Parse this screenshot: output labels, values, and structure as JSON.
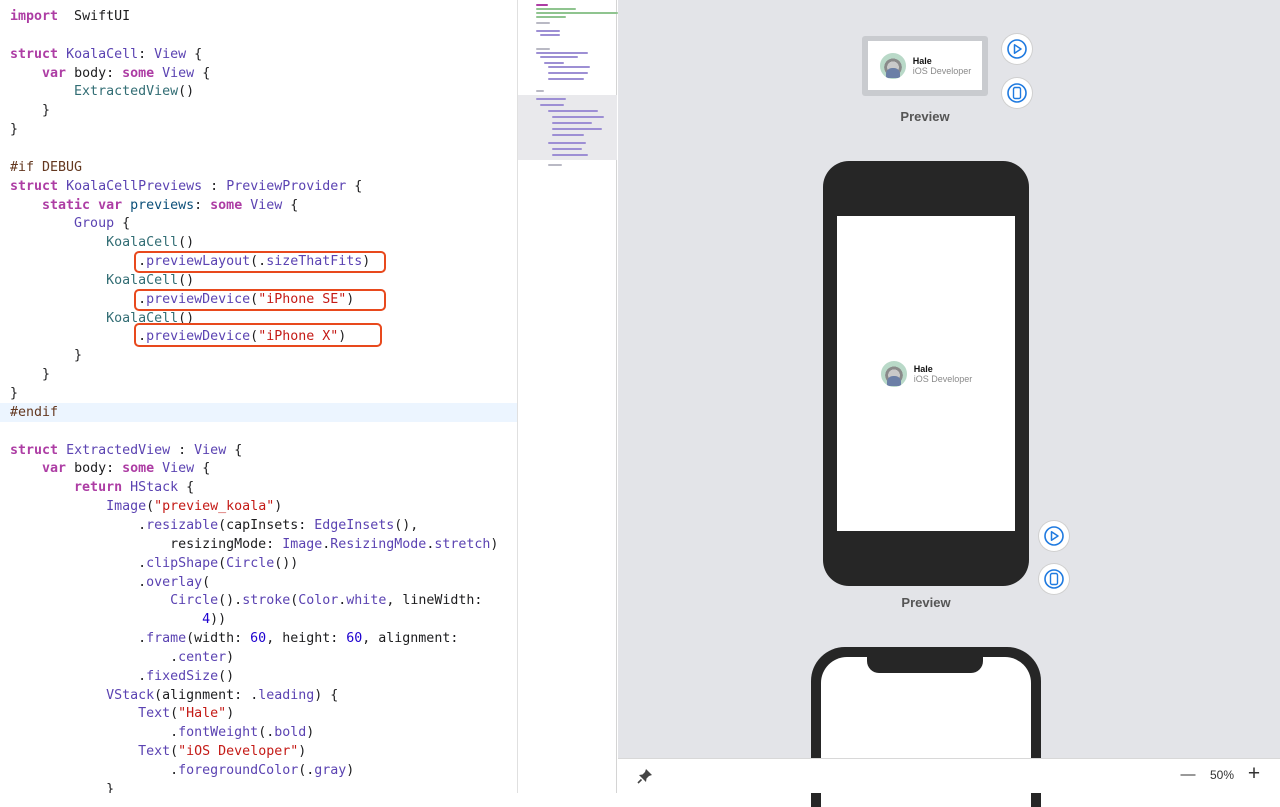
{
  "code_lines": [
    {
      "n": 1,
      "parts": [
        [
          "kw",
          "import"
        ],
        [
          "",
          "  SwiftUI"
        ]
      ]
    },
    {
      "n": 2,
      "parts": []
    },
    {
      "n": 3,
      "parts": [
        [
          "kw",
          "struct"
        ],
        [
          "",
          " "
        ],
        [
          "ty",
          "KoalaCell"
        ],
        [
          "",
          ": "
        ],
        [
          "ty",
          "View"
        ],
        [
          "",
          " {"
        ]
      ]
    },
    {
      "n": 4,
      "parts": [
        [
          "",
          "    "
        ],
        [
          "kw",
          "var"
        ],
        [
          "",
          " body: "
        ],
        [
          "kw",
          "some"
        ],
        [
          "",
          " "
        ],
        [
          "ty",
          "View"
        ],
        [
          "",
          " {"
        ]
      ]
    },
    {
      "n": 5,
      "parts": [
        [
          "",
          "        "
        ],
        [
          "dt",
          "ExtractedView"
        ],
        [
          "",
          "()"
        ]
      ]
    },
    {
      "n": 6,
      "parts": [
        [
          "",
          "    }"
        ]
      ]
    },
    {
      "n": 7,
      "parts": [
        [
          "",
          "}"
        ]
      ]
    },
    {
      "n": 8,
      "parts": []
    },
    {
      "n": 9,
      "parts": [
        [
          "pp",
          "#if DEBUG"
        ]
      ]
    },
    {
      "n": 10,
      "parts": [
        [
          "kw",
          "struct"
        ],
        [
          "",
          " "
        ],
        [
          "ty",
          "KoalaCellPreviews"
        ],
        [
          "",
          " : "
        ],
        [
          "ty",
          "PreviewProvider"
        ],
        [
          "",
          " {"
        ]
      ]
    },
    {
      "n": 11,
      "parts": [
        [
          "",
          "    "
        ],
        [
          "kw",
          "static var"
        ],
        [
          "",
          " "
        ],
        [
          "cl",
          "previews"
        ],
        [
          "",
          ": "
        ],
        [
          "kw",
          "some"
        ],
        [
          "",
          " "
        ],
        [
          "ty",
          "View"
        ],
        [
          "",
          " {"
        ]
      ]
    },
    {
      "n": 12,
      "parts": [
        [
          "",
          "        "
        ],
        [
          "ty",
          "Group"
        ],
        [
          "",
          " {"
        ]
      ]
    },
    {
      "n": 13,
      "parts": [
        [
          "",
          "            "
        ],
        [
          "dt",
          "KoalaCell"
        ],
        [
          "",
          "()"
        ]
      ]
    },
    {
      "n": 14,
      "parts": [
        [
          "",
          "                ."
        ],
        [
          "ty",
          "previewLayout"
        ],
        [
          "",
          "(."
        ],
        [
          "ty",
          "sizeThatFits"
        ],
        [
          "",
          ")"
        ]
      ]
    },
    {
      "n": 15,
      "parts": [
        [
          "",
          "            "
        ],
        [
          "dt",
          "KoalaCell"
        ],
        [
          "",
          "()"
        ]
      ]
    },
    {
      "n": 16,
      "parts": [
        [
          "",
          "                ."
        ],
        [
          "ty",
          "previewDevice"
        ],
        [
          "",
          "("
        ],
        [
          "st",
          "\"iPhone SE\""
        ],
        [
          "",
          ")"
        ]
      ]
    },
    {
      "n": 17,
      "parts": [
        [
          "",
          "            "
        ],
        [
          "dt",
          "KoalaCell"
        ],
        [
          "",
          "()"
        ]
      ]
    },
    {
      "n": 18,
      "parts": [
        [
          "",
          "                ."
        ],
        [
          "ty",
          "previewDevice"
        ],
        [
          "",
          "("
        ],
        [
          "st",
          "\"iPhone X\""
        ],
        [
          "",
          ")"
        ]
      ]
    },
    {
      "n": 19,
      "parts": [
        [
          "",
          "        }"
        ]
      ]
    },
    {
      "n": 20,
      "parts": [
        [
          "",
          "    }"
        ]
      ]
    },
    {
      "n": 21,
      "parts": [
        [
          "",
          "}"
        ]
      ]
    },
    {
      "n": 22,
      "parts": [
        [
          "pp",
          "#endif"
        ]
      ]
    },
    {
      "n": 23,
      "parts": []
    },
    {
      "n": 24,
      "parts": [
        [
          "kw",
          "struct"
        ],
        [
          "",
          " "
        ],
        [
          "ty",
          "ExtractedView"
        ],
        [
          "",
          " : "
        ],
        [
          "ty",
          "View"
        ],
        [
          "",
          " {"
        ]
      ]
    },
    {
      "n": 25,
      "parts": [
        [
          "",
          "    "
        ],
        [
          "kw",
          "var"
        ],
        [
          "",
          " body: "
        ],
        [
          "kw",
          "some"
        ],
        [
          "",
          " "
        ],
        [
          "ty",
          "View"
        ],
        [
          "",
          " {"
        ]
      ]
    },
    {
      "n": 26,
      "parts": [
        [
          "",
          "        "
        ],
        [
          "kw",
          "return"
        ],
        [
          "",
          " "
        ],
        [
          "ty",
          "HStack"
        ],
        [
          "",
          " {"
        ]
      ]
    },
    {
      "n": 27,
      "parts": [
        [
          "",
          "            "
        ],
        [
          "ty",
          "Image"
        ],
        [
          "",
          "("
        ],
        [
          "st",
          "\"preview_koala\""
        ],
        [
          "",
          ")"
        ]
      ]
    },
    {
      "n": 28,
      "parts": [
        [
          "",
          "                ."
        ],
        [
          "ty",
          "resizable"
        ],
        [
          "",
          "(capInsets: "
        ],
        [
          "ty",
          "EdgeInsets"
        ],
        [
          "",
          "(),"
        ]
      ]
    },
    {
      "n": 29,
      "parts": [
        [
          "",
          "                    resizingMode: "
        ],
        [
          "ty",
          "Image"
        ],
        [
          "",
          "."
        ],
        [
          "ty",
          "ResizingMode"
        ],
        [
          "",
          "."
        ],
        [
          "ty",
          "stretch"
        ],
        [
          "",
          ")"
        ]
      ]
    },
    {
      "n": 30,
      "parts": [
        [
          "",
          "                ."
        ],
        [
          "ty",
          "clipShape"
        ],
        [
          "",
          "("
        ],
        [
          "ty",
          "Circle"
        ],
        [
          "",
          "())"
        ]
      ]
    },
    {
      "n": 31,
      "parts": [
        [
          "",
          "                ."
        ],
        [
          "ty",
          "overlay"
        ],
        [
          "",
          "("
        ]
      ]
    },
    {
      "n": 32,
      "parts": [
        [
          "",
          "                    "
        ],
        [
          "ty",
          "Circle"
        ],
        [
          "",
          "()."
        ],
        [
          "ty",
          "stroke"
        ],
        [
          "",
          "("
        ],
        [
          "ty",
          "Color"
        ],
        [
          "",
          "."
        ],
        [
          "ty",
          "white"
        ],
        [
          "",
          ", lineWidth:"
        ]
      ]
    },
    {
      "n": 33,
      "parts": [
        [
          "",
          "                        "
        ],
        [
          "nm",
          "4"
        ],
        [
          "",
          "))"
        ]
      ]
    },
    {
      "n": 34,
      "parts": [
        [
          "",
          "                ."
        ],
        [
          "ty",
          "frame"
        ],
        [
          "",
          "(width: "
        ],
        [
          "nm",
          "60"
        ],
        [
          "",
          ", height: "
        ],
        [
          "nm",
          "60"
        ],
        [
          "",
          ", alignment:"
        ]
      ]
    },
    {
      "n": 35,
      "parts": [
        [
          "",
          "                    ."
        ],
        [
          "ty",
          "center"
        ],
        [
          "",
          ")"
        ]
      ]
    },
    {
      "n": 36,
      "parts": [
        [
          "",
          "                ."
        ],
        [
          "ty",
          "fixedSize"
        ],
        [
          "",
          "()"
        ]
      ]
    },
    {
      "n": 37,
      "parts": [
        [
          "",
          "            "
        ],
        [
          "ty",
          "VStack"
        ],
        [
          "",
          "(alignment: ."
        ],
        [
          "ty",
          "leading"
        ],
        [
          "",
          ") {"
        ]
      ]
    },
    {
      "n": 38,
      "parts": [
        [
          "",
          "                "
        ],
        [
          "ty",
          "Text"
        ],
        [
          "",
          "("
        ],
        [
          "st",
          "\"Hale\""
        ],
        [
          "",
          ")"
        ]
      ]
    },
    {
      "n": 39,
      "parts": [
        [
          "",
          "                    ."
        ],
        [
          "ty",
          "fontWeight"
        ],
        [
          "",
          "(."
        ],
        [
          "ty",
          "bold"
        ],
        [
          "",
          ")"
        ]
      ]
    },
    {
      "n": 40,
      "parts": [
        [
          "",
          "                "
        ],
        [
          "ty",
          "Text"
        ],
        [
          "",
          "("
        ],
        [
          "st",
          "\"iOS Developer\""
        ],
        [
          "",
          ")"
        ]
      ]
    },
    {
      "n": 41,
      "parts": [
        [
          "",
          "                    ."
        ],
        [
          "ty",
          "foregroundColor"
        ],
        [
          "",
          "(."
        ],
        [
          "ty",
          "gray"
        ],
        [
          "",
          ")"
        ]
      ]
    },
    {
      "n": 42,
      "parts": [
        [
          "",
          "            }"
        ]
      ]
    }
  ],
  "highlighted_line": 22,
  "previews": {
    "label": "Preview",
    "cell_name": "Hale",
    "cell_role": "iOS Developer"
  },
  "bottombar": {
    "zoom": "50%",
    "zoom_out_symbol": "—",
    "zoom_in_symbol": "+"
  },
  "icons": {
    "play": "play-circle-icon",
    "device": "device-inspect-icon",
    "pin": "pin-icon"
  },
  "colors": {
    "accent": "#1f7ae0",
    "highlight_box": "#e8491d",
    "canvas_bg": "#e3e4e8",
    "device_body": "#262626"
  }
}
